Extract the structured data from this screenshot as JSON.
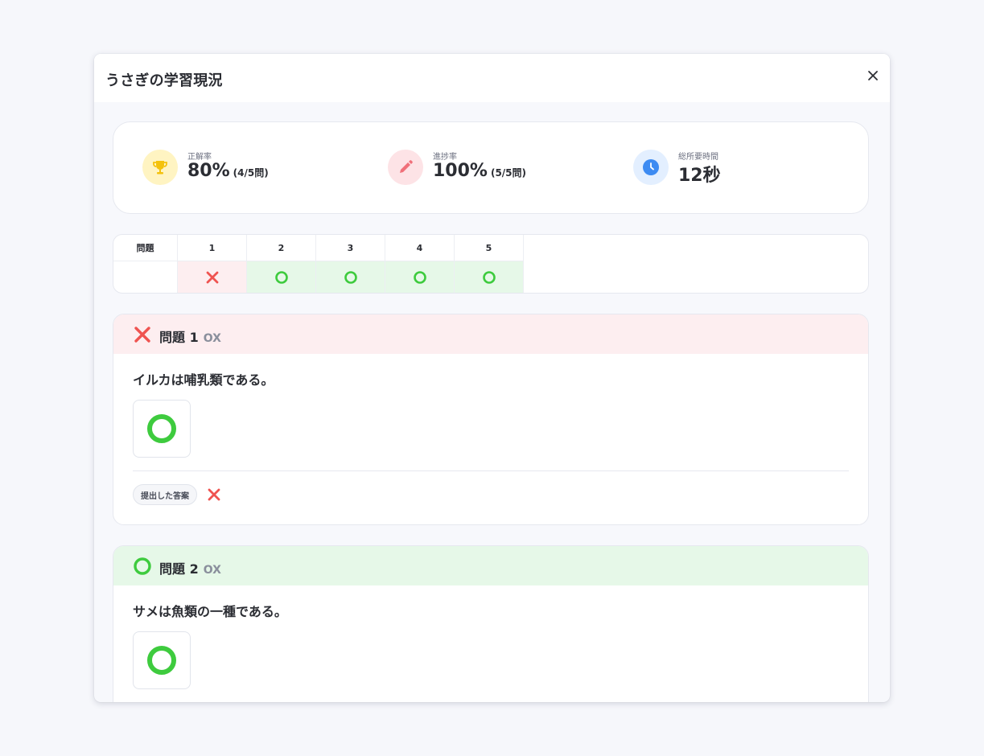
{
  "modal": {
    "title": "うさぎの学習現況",
    "close_icon": "close-icon"
  },
  "stats": [
    {
      "icon": "trophy-icon",
      "label": "正解率",
      "value": "80%",
      "sub": "(4/5問)",
      "icon_bg": "#fff4c2",
      "icon_color": "#f4c20d"
    },
    {
      "icon": "pencil-icon",
      "label": "進捗率",
      "value": "100%",
      "sub": "(5/5問)",
      "icon_bg": "#fde3e6",
      "icon_color": "#f0707a"
    },
    {
      "icon": "clock-icon",
      "label": "総所要時間",
      "value": "12秒",
      "sub": "",
      "icon_bg": "#e3efff",
      "icon_color": "#3d8bf2"
    }
  ],
  "grid": {
    "header_label": "問題",
    "questions": [
      "1",
      "2",
      "3",
      "4",
      "5"
    ],
    "results": [
      "wrong",
      "right",
      "right",
      "right",
      "right"
    ]
  },
  "questions": [
    {
      "status": "wrong",
      "title": "問題 1",
      "type": "OX",
      "text": "イルカは哺乳類である。",
      "choice": "O",
      "submitted_label": "提出した答案",
      "submitted": "X"
    },
    {
      "status": "right",
      "title": "問題 2",
      "type": "OX",
      "text": "サメは魚類の一種である。",
      "choice": "O"
    }
  ],
  "colors": {
    "wrong": "#ef5350",
    "right": "#3ecb3e",
    "wrong_bg": "#fdeef0",
    "right_bg": "#e6f8e8"
  }
}
